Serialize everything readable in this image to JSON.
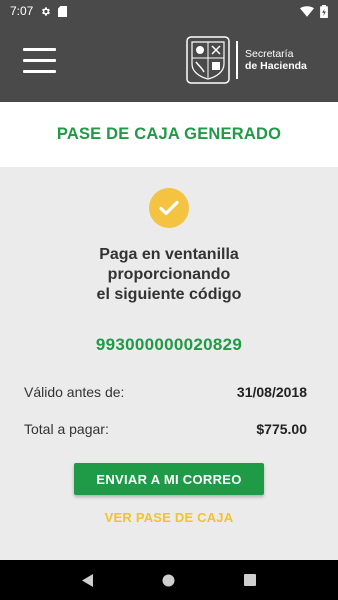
{
  "status_bar": {
    "time": "7:07",
    "icons": [
      "gear-icon",
      "sd-card-icon",
      "wifi-icon",
      "battery-icon"
    ]
  },
  "app_bar": {
    "menu_icon": "hamburger-menu-icon",
    "brand_line1": "Secretaría",
    "brand_line2": "de Hacienda",
    "background": "#4a4a4a"
  },
  "header": {
    "title": "PASE DE CAJA GENERADO",
    "color": "#1f9a46"
  },
  "main": {
    "status_icon": "checkmark-icon",
    "message_lines": [
      "Paga en ventanilla",
      "proporcionando",
      "el siguiente código"
    ],
    "code": "993000000020829",
    "valid_label": "Válido antes de:",
    "valid_value": "31/08/2018",
    "total_label": "Total a pagar:",
    "total_value": "$775.00",
    "email_button": "ENVIAR A MI CORREO",
    "view_link": "VER PASE DE CAJA"
  },
  "colors": {
    "accent_green": "#1f9a46",
    "accent_yellow": "#f5c342",
    "content_bg": "#ebebeb"
  },
  "nav_bar": {
    "buttons": [
      "back-triangle-icon",
      "home-circle-icon",
      "recents-square-icon"
    ]
  }
}
